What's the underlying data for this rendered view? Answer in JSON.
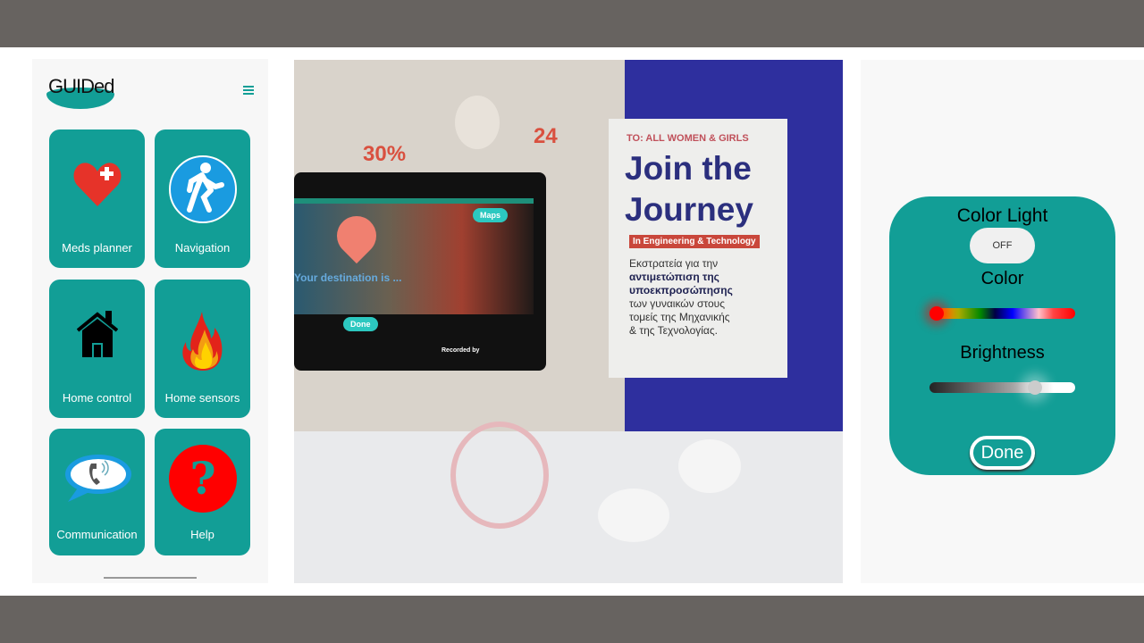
{
  "app": {
    "logo_text": "GUIDed",
    "menu_icon": "hamburger-icon"
  },
  "tiles": [
    {
      "label": "Meds planner",
      "icon": "heart-plus-icon"
    },
    {
      "label": "Navigation",
      "icon": "pedestrian-icon"
    },
    {
      "label": "Home control",
      "icon": "house-icon"
    },
    {
      "label": "Home sensors",
      "icon": "fire-icon"
    },
    {
      "label": "Communication",
      "icon": "phone-bubble-icon"
    },
    {
      "label": "Help",
      "icon": "question-icon"
    }
  ],
  "photo": {
    "poster": {
      "to": "TO: ALL WOMEN & GIRLS",
      "title1": "Join the",
      "title2": "Journey",
      "tag": "In Engineering & Technology",
      "greek": [
        "Εκστρατεία για την",
        "αντιμετώπιση της",
        "υποεκπροσώπησης",
        "των γυναικών στους",
        "τομείς της Μηχανικής",
        "& της Τεχνολογίας."
      ]
    },
    "stats": [
      "30%",
      "24"
    ],
    "screen": {
      "maps": "Maps",
      "message": "Your destination is ...",
      "done": "Done",
      "recorded": "Recorded by"
    }
  },
  "color_light": {
    "title": "Color Light",
    "toggle": "OFF",
    "color_label": "Color",
    "color_value": 0,
    "brightness_label": "Brightness",
    "brightness_value": 0.75,
    "done": "Done",
    "colors": {
      "teal": "#129e96"
    }
  }
}
